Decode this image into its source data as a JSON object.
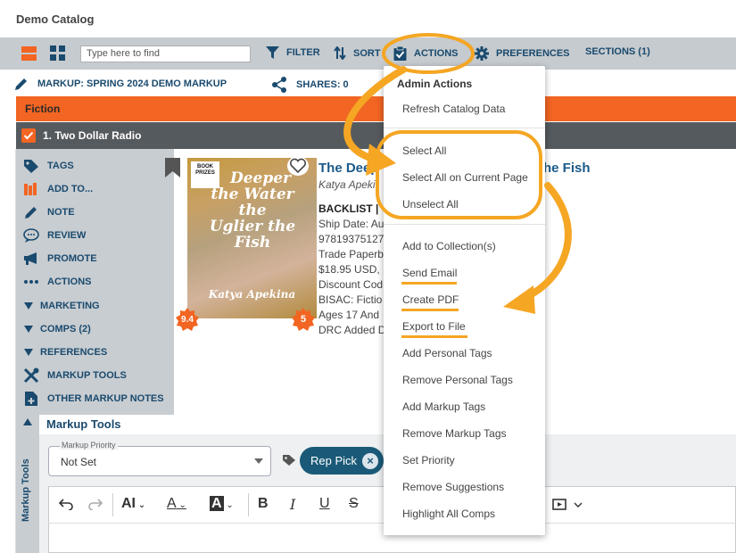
{
  "app": {
    "title": "Demo Catalog"
  },
  "toolbar": {
    "search_placeholder": "Type here to find",
    "filter_label": "FILTER",
    "sort_label": "SORT",
    "actions_label": "ACTIONS",
    "preferences_label": "PREFERENCES",
    "sections_label": "SECTIONS (1)"
  },
  "markup_bar": {
    "markup_label": "MARKUP: SPRING 2024 DEMO MARKUP",
    "shares_label": "SHARES: 0"
  },
  "section": {
    "name": "Fiction"
  },
  "publisher": {
    "label": "1. Two Dollar Radio"
  },
  "side_menu": {
    "tags": "TAGS",
    "add_to": "ADD TO...",
    "note": "NOTE",
    "review": "REVIEW",
    "promote": "PROMOTE",
    "actions": "ACTIONS",
    "marketing": "MARKETING",
    "comps": "COMPS (2)",
    "references": "REFERENCES",
    "markup_tools": "MARKUP TOOLS",
    "other_notes": "OTHER MARKUP NOTES"
  },
  "book": {
    "title_visible_left": "The Deep",
    "title_visible_right": "he Fish",
    "author": "Katya Apeki",
    "status": "BACKLIST |",
    "ship_date": "Ship Date: Au",
    "isbn": "97819375127",
    "format": "Trade Paperb",
    "price": "$18.95 USD,",
    "discount": "Discount Cod",
    "bisac": "BISAC: Fictio",
    "ages": "Ages 17 And",
    "drc": "DRC Added D",
    "cover_title_lines": [
      "Deeper",
      "the Water the",
      "Uglier the",
      "Fish"
    ],
    "cover_author": "Katya Apekina",
    "cover_prize_line1": "BOOK",
    "cover_prize_line2": "PRIZES",
    "badge_left": "9.4",
    "badge_right": "5"
  },
  "markup_tools": {
    "strip_label": "Markup Tools",
    "heading": "Markup Tools",
    "priority_legend": "Markup Priority",
    "priority_value": "Not Set",
    "pill_label": "Rep Pick"
  },
  "dropdown": {
    "header": "Admin Actions",
    "items": {
      "refresh": "Refresh Catalog Data",
      "select_all": "Select All",
      "select_all_page": "Select All on Current Page",
      "unselect_all": "Unselect All",
      "add_collection": "Add to Collection(s)",
      "send_email": "Send Email",
      "create_pdf": "Create PDF",
      "export_file": "Export to File",
      "add_personal": "Add Personal Tags",
      "remove_personal": "Remove Personal Tags",
      "add_markup": "Add Markup Tags",
      "remove_markup": "Remove Markup Tags",
      "set_priority": "Set Priority",
      "remove_suggestions": "Remove Suggestions",
      "highlight_comps": "Highlight All Comps"
    }
  },
  "colors": {
    "accent_orange": "#f26522",
    "annotation_orange": "#f5a623",
    "brand_navy": "#1a4a6e",
    "toolbar_gray": "#c6cbcf",
    "pill_teal": "#1a5a78"
  },
  "icons": {
    "list_view": "list-view-icon",
    "grid_view": "grid-view-icon",
    "filter": "filter-icon",
    "sort": "sort-icon",
    "actions": "clipboard-check-icon",
    "preferences": "gear-icon",
    "markup": "pencil-icon",
    "shares": "share-icon",
    "tags": "tag-icon",
    "add_to": "books-icon",
    "note": "pencil-icon",
    "review": "speech-bubble-icon",
    "promote": "megaphone-icon",
    "actions_dots": "ellipsis-icon",
    "markup_tools": "tools-icon",
    "other_notes": "add-document-icon"
  }
}
